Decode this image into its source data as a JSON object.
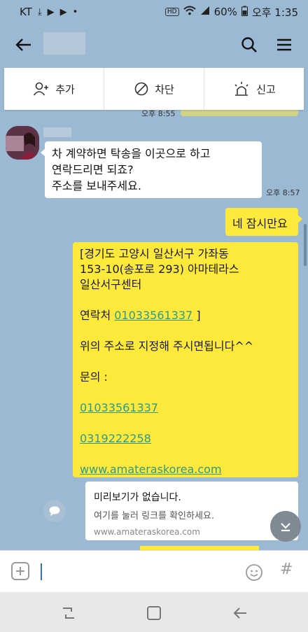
{
  "status": {
    "carrier": "KT",
    "hd": "HD",
    "battery": "60%",
    "time": "오후 1:35"
  },
  "actions": {
    "add": "추가",
    "block": "차단",
    "report": "신고"
  },
  "times": {
    "t1": "오후 8:55",
    "t2": "오후 8:57"
  },
  "incoming": {
    "lines": [
      "차 계약하면 탁송을 이곳으로 하고",
      "연락드리면 되죠?",
      "주소를 보내주세요."
    ]
  },
  "outgoing_small": "네 잠시만요",
  "address": {
    "line1": "[경기도 고양시 일산서구 가좌동",
    "line2": "153-10(송포로 293) 아마테라스",
    "line3": "일산서구센터",
    "contact_label": "연락처 ",
    "contact_phone": "01033561337",
    "contact_end": " ]",
    "notice": "위의 주소로 지정해 주시면됩니다^^",
    "inquiry": "문의 :",
    "phone1": "01033561337",
    "phone2": "0319222258",
    "website": "www.amateraskorea.com"
  },
  "preview": {
    "title": "미리보기가 없습니다.",
    "subtitle": "여기를 눌러 링크를 확인하세요.",
    "url": "www.amateraskorea.com"
  },
  "input": {
    "hash": "#"
  }
}
